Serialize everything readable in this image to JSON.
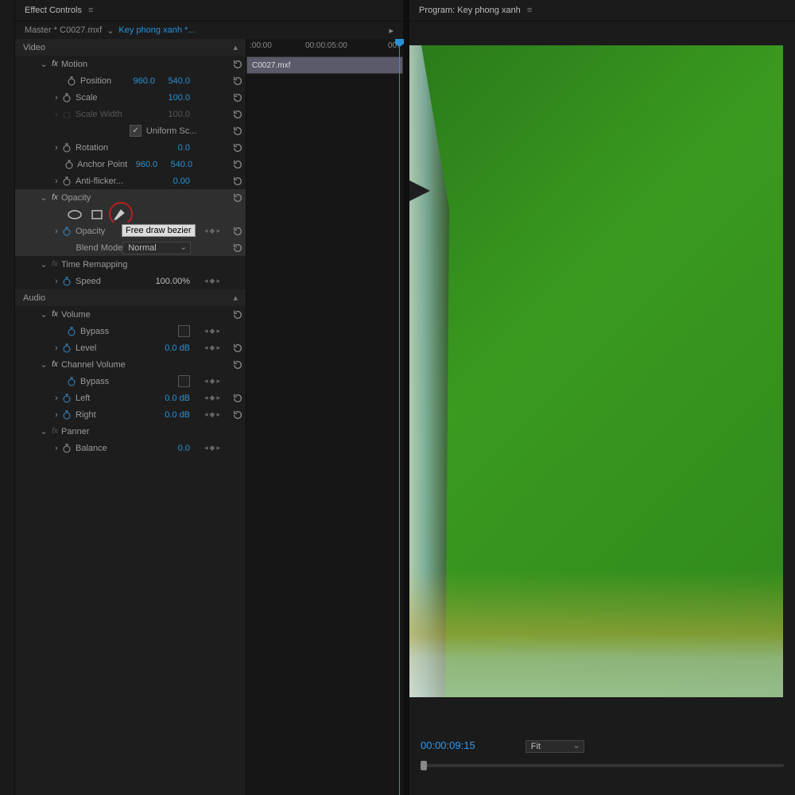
{
  "panels": {
    "effect_controls_title": "Effect Controls",
    "program_title": "Program: Key phong xanh"
  },
  "master": {
    "label": "Master * C0027.mxf",
    "link": "Key phong xanh *..."
  },
  "sections": {
    "video": "Video",
    "audio": "Audio"
  },
  "motion": {
    "name": "Motion",
    "position_label": "Position",
    "position_x": "960.0",
    "position_y": "540.0",
    "scale_label": "Scale",
    "scale_val": "100.0",
    "scale_width_label": "Scale Width",
    "scale_width_val": "100.0",
    "uniform_label": "Uniform Sc...",
    "rotation_label": "Rotation",
    "rotation_val": "0.0",
    "anchor_label": "Anchor Point",
    "anchor_x": "960.0",
    "anchor_y": "540.0",
    "antiflicker_label": "Anti-flicker...",
    "antiflicker_val": "0.00"
  },
  "opacity": {
    "name": "Opacity",
    "tooltip": "Free draw bezier",
    "opacity_label": "Opacity",
    "blend_label": "Blend Mode",
    "blend_value": "Normal"
  },
  "time_remap": {
    "name": "Time Remapping",
    "speed_label": "Speed",
    "speed_val": "100.00%"
  },
  "volume": {
    "name": "Volume",
    "bypass_label": "Bypass",
    "level_label": "Level",
    "level_val": "0.0 dB"
  },
  "channel_volume": {
    "name": "Channel Volume",
    "bypass_label": "Bypass",
    "left_label": "Left",
    "left_val": "0.0 dB",
    "right_label": "Right",
    "right_val": "0.0 dB"
  },
  "panner": {
    "name": "Panner",
    "balance_label": "Balance",
    "balance_val": "0.0"
  },
  "timeline": {
    "t0": ":00:00",
    "t1": "00:00:05:00",
    "t2": "00:",
    "clip": "C0027.mxf"
  },
  "program": {
    "timecode": "00:00:09:15",
    "fit": "Fit"
  }
}
